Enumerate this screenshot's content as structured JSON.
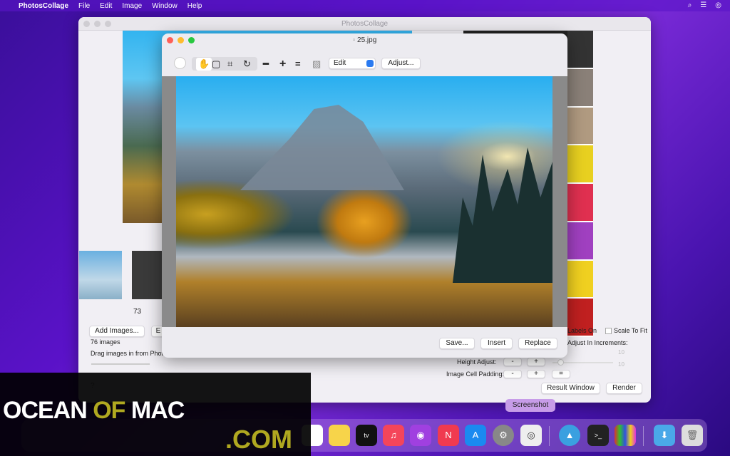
{
  "menubar": {
    "app": "PhotosCollage",
    "items": [
      "File",
      "Edit",
      "Image",
      "Window",
      "Help"
    ]
  },
  "main_window": {
    "title": "PhotosCollage",
    "thumb_label": "73",
    "add_images": "Add Images...",
    "e_btn": "E",
    "count": "76 images",
    "drag_hint": "Drag images in from Photo",
    "labels_on": "Labels On",
    "scale_to_fit": "Scale To Fit",
    "adjust_increments": "Adjust In Increments:",
    "val1": "10",
    "val2": "10",
    "height_adjust": "Height Adjust:",
    "cell_padding": "Image Cell Padding:",
    "minus": "-",
    "plus": "+",
    "equals": "=",
    "result_window": "Result Window",
    "render": "Render",
    "help": "?"
  },
  "editor": {
    "title": "25.jpg",
    "mode_select": "Edit",
    "adjust": "Adjust...",
    "save": "Save...",
    "insert": "Insert",
    "replace": "Replace"
  },
  "watermark": {
    "line1a": "OCEAN ",
    "line1b": "OF",
    "line1c": " MAC",
    "line2": ".COM"
  },
  "dock": {
    "tooltip": "Screenshot"
  },
  "colors": {
    "accent": "#5a12c8",
    "close": "#fe5f57",
    "minimize": "#febc2e",
    "zoom": "#28c840"
  }
}
